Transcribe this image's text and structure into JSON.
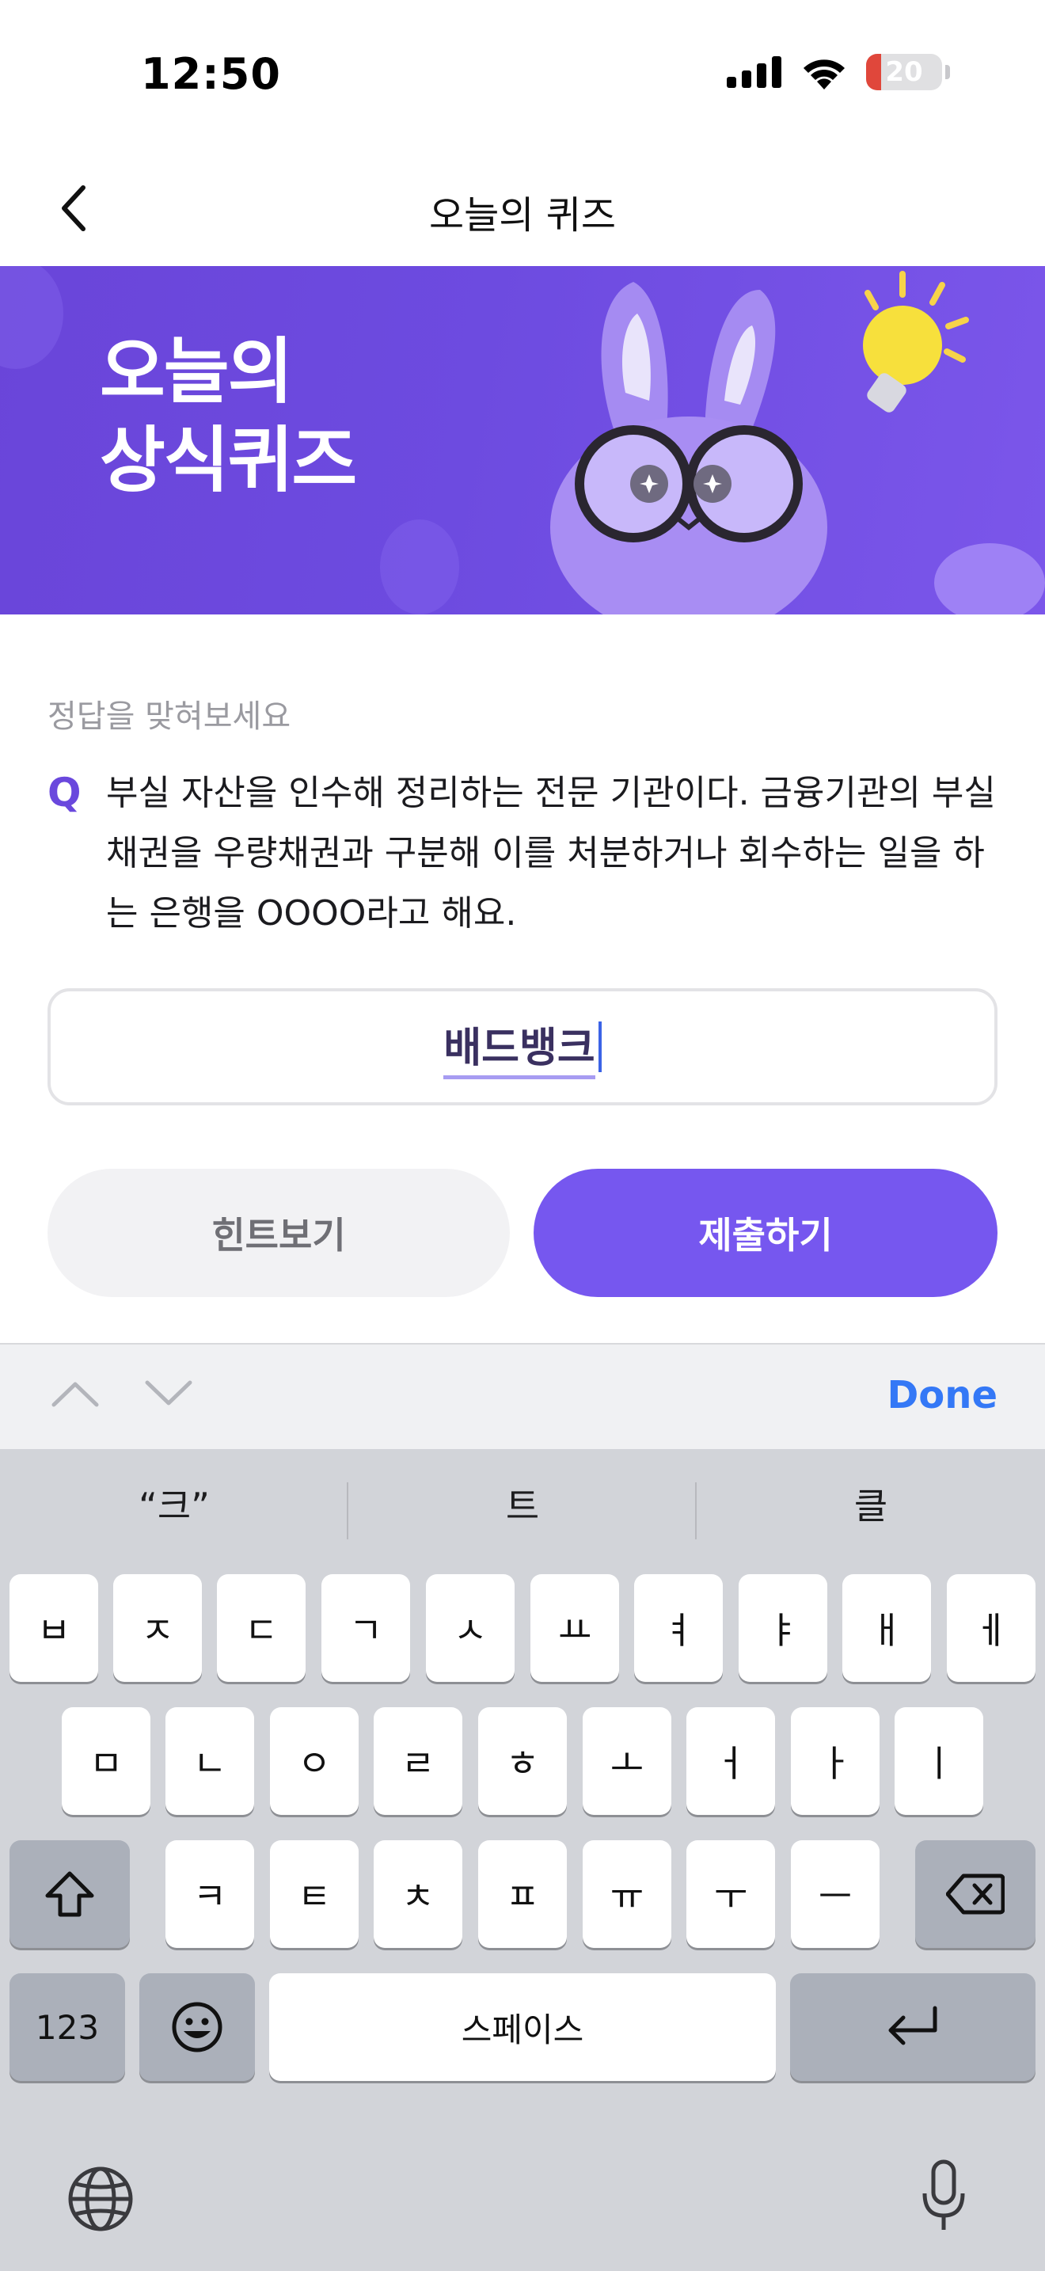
{
  "status_bar": {
    "time": "12:50",
    "battery": "20",
    "battery_level": 0.2,
    "battery_color": "#e0473b"
  },
  "nav": {
    "title": "오늘의 퀴즈"
  },
  "banner": {
    "title_line1": "오늘의",
    "title_line2": "상식퀴즈"
  },
  "quiz": {
    "prompt": "정답을 맞혀보세요",
    "q_mark": "Q",
    "question": "부실 자산을 인수해 정리하는 전문 기관이다. 금융기관의 부실채권을 우량채권과 구분해 이를 처분하거나 회수하는 일을 하는 은행을 OOOO라고 해요.",
    "answer_value": "배드뱅크"
  },
  "buttons": {
    "hint": "힌트보기",
    "submit": "제출하기"
  },
  "accessory": {
    "done": "Done"
  },
  "keyboard": {
    "suggestions": [
      "“크”",
      "트",
      "클"
    ],
    "row1": [
      "ㅂ",
      "ㅈ",
      "ㄷ",
      "ㄱ",
      "ㅅ",
      "ㅛ",
      "ㅕ",
      "ㅑ",
      "ㅐ",
      "ㅔ"
    ],
    "row2": [
      "ㅁ",
      "ㄴ",
      "ㅇ",
      "ㄹ",
      "ㅎ",
      "ㅗ",
      "ㅓ",
      "ㅏ",
      "ㅣ"
    ],
    "row3": [
      "ㅋ",
      "ㅌ",
      "ㅊ",
      "ㅍ",
      "ㅠ",
      "ㅜ",
      "ㅡ"
    ],
    "numbers_key": "123",
    "space": "스페이스"
  },
  "colors": {
    "accent": "#7657ef",
    "banner": "#6a45d9",
    "link": "#3478f6"
  }
}
